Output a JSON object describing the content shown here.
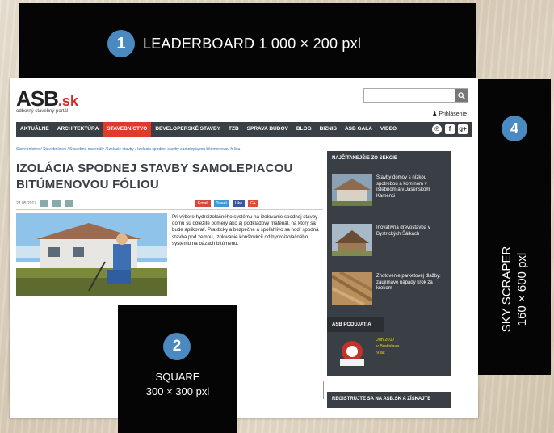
{
  "ads": {
    "leaderboard": {
      "number": "1",
      "label": "LEADERBOARD   1 000 × 200 pxl"
    },
    "square": {
      "number": "2",
      "line1": "SQUARE",
      "line2": "300 × 300 pxl"
    },
    "skyscraper": {
      "number": "4",
      "line1": "SKY SCRAPER",
      "line2": "160 × 600 pxl"
    }
  },
  "site": {
    "logo": {
      "name": "ASB",
      "tld": ".sk",
      "tagline": "odborný stavebný portál"
    },
    "login_label": "Prihlásenie",
    "nav": [
      {
        "label": "AKTUÁLNE"
      },
      {
        "label": "ARCHITEKTÚRA"
      },
      {
        "label": "STAVEBNÍCTVO",
        "active": true
      },
      {
        "label": "DEVELOPERSKÉ STAVBY"
      },
      {
        "label": "TZB"
      },
      {
        "label": "SPRAVA BUDOV"
      },
      {
        "label": "BLOG"
      },
      {
        "label": "BIZNIS"
      },
      {
        "label": "ASB GALA"
      },
      {
        "label": "VIDEO"
      }
    ],
    "social": [
      "℗",
      "f",
      "g+"
    ],
    "breadcrumb": "Stavebníctvo / Stavebníctvo / Stavebné materiály / Izolácie stavby / Izolácia spodnej stavby samolepiacou bitúmenovou fóliou",
    "article": {
      "title": "IZOLÁCIA SPODNEJ STAVBY SAMOLEPIACOU BITÚMENOVOU FÓLIOU",
      "date": "27.05.2017",
      "share": [
        "Email",
        "Tweet",
        "Like",
        "G+"
      ],
      "body": "Pri výbere hydroizolačného systému na izolovanie spodnej stavby domu sú dôležité pomery ako aj podkladový materiál, na ktorý sa bude aplikovať. Prakticky a bezpečne a spoľahlivo sa hodí spodná stavba pod zemou, izolovanie konštrukcií od hydroizolačného systému na bázach bitúmenu."
    },
    "sidebar": {
      "popular_title": "NAJČÍTANEJŠIE ZO SEKCIE",
      "popular": [
        {
          "caption": "Stavby domov s nízkou spotrebou a komínom v Istebnom a v Jasenskom Kamenci"
        },
        {
          "caption": "Inovatívna drevostavba v Bystrických Šálkach"
        },
        {
          "caption": "Zhotovenie parketovej dlažby: zaujímavé nápady krok za krokom"
        }
      ],
      "events_title": "ASB PODUJATIA",
      "event": {
        "date": "Jún 2017",
        "location": "v Bratislave",
        "more": "Viac"
      },
      "register_title": "REGISTRUJTE SA NA ASB.SK A ZÍSKAJTE"
    }
  }
}
